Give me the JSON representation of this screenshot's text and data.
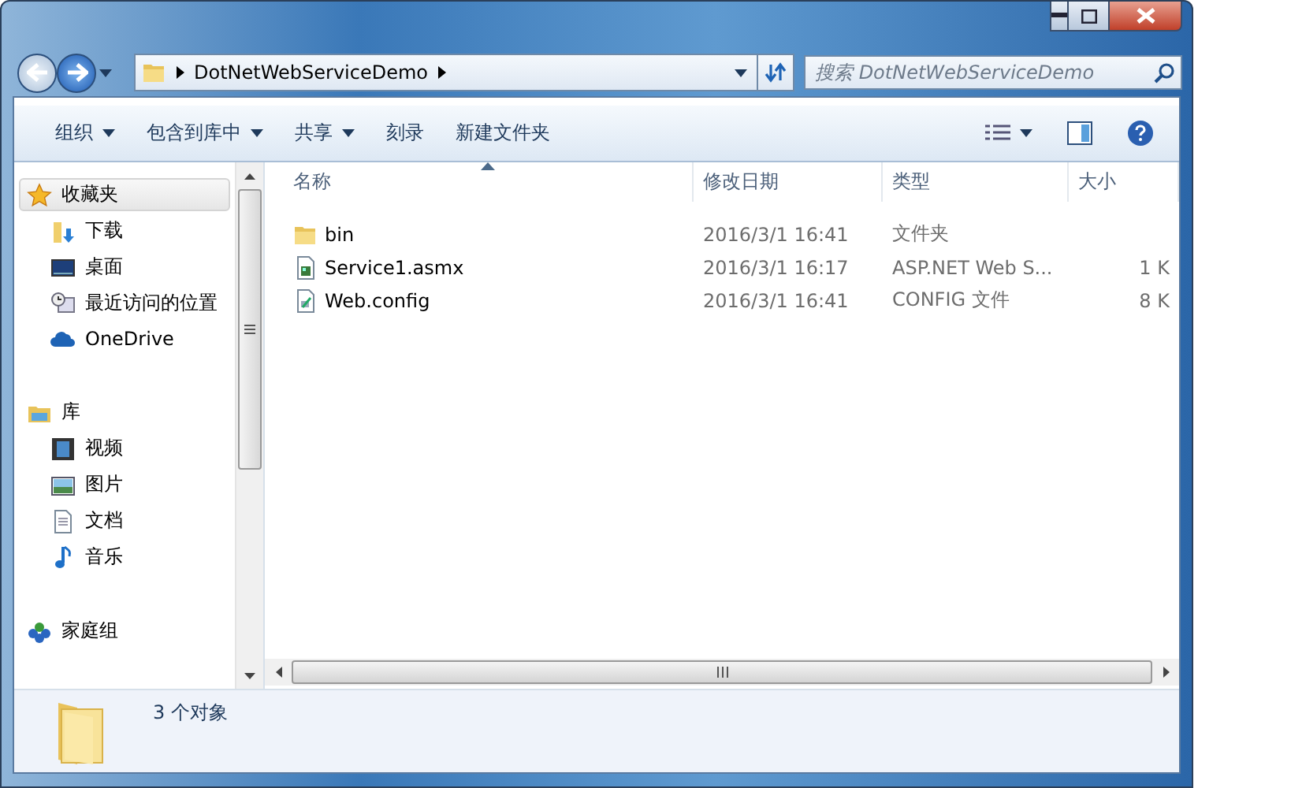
{
  "address": {
    "path": [
      "DotNetWebServiceDemo"
    ]
  },
  "search": {
    "placeholder": "搜索 DotNetWebServiceDemo"
  },
  "toolbar": [
    {
      "label": "组织",
      "has_menu": true
    },
    {
      "label": "包含到库中",
      "has_menu": true
    },
    {
      "label": "共享",
      "has_menu": true
    },
    {
      "label": "刻录",
      "has_menu": false
    },
    {
      "label": "新建文件夹",
      "has_menu": false
    }
  ],
  "sidebar": {
    "groups": [
      {
        "label": "收藏夹",
        "kind": "star",
        "selected": true,
        "children": [
          {
            "label": "下载",
            "kind": "download",
            "selected": false
          },
          {
            "label": "桌面",
            "kind": "desktop",
            "selected": false
          },
          {
            "label": "最近访问的位置",
            "kind": "recent",
            "selected": false
          },
          {
            "label": "OneDrive",
            "kind": "cloud",
            "selected": false
          }
        ]
      },
      {
        "label": "库",
        "kind": "library",
        "selected": false,
        "children": [
          {
            "label": "视频",
            "kind": "video",
            "selected": false
          },
          {
            "label": "图片",
            "kind": "picture",
            "selected": false
          },
          {
            "label": "文档",
            "kind": "document",
            "selected": false
          },
          {
            "label": "音乐",
            "kind": "music",
            "selected": false
          }
        ]
      },
      {
        "label": "家庭组",
        "kind": "homegroup",
        "selected": false
      }
    ]
  },
  "table": {
    "columns": [
      {
        "label": "名称",
        "sorted": true
      },
      {
        "label": "修改日期",
        "sorted": false
      },
      {
        "label": "类型",
        "sorted": false
      },
      {
        "label": "大小",
        "sorted": false
      }
    ],
    "rows": [
      {
        "kind": "folder",
        "name": "bin",
        "date": "2016/3/1 16:41",
        "type": "文件夹"
      },
      {
        "kind": "asmx",
        "name": "Service1.asmx",
        "date": "2016/3/1 16:17",
        "type": "ASP.NET Web S...",
        "size": "1 K"
      },
      {
        "kind": "config",
        "name": "Web.config",
        "date": "2016/3/1 16:41",
        "type": "CONFIG 文件",
        "size": "8 K"
      }
    ]
  },
  "status_bar": {
    "text": "3 个对象"
  }
}
